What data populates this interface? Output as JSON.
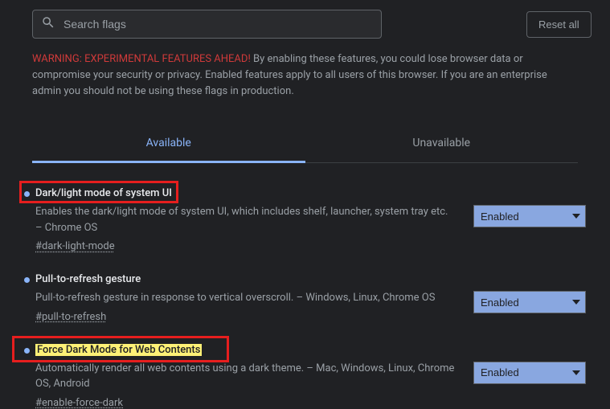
{
  "search": {
    "placeholder": "Search flags"
  },
  "reset_label": "Reset all",
  "warning": {
    "prefix": "WARNING: EXPERIMENTAL FEATURES AHEAD!",
    "body": " By enabling these features, you could lose browser data or compromise your security or privacy. Enabled features apply to all users of this browser. If you are an enterprise admin you should not be using these flags in production."
  },
  "tabs": {
    "available": "Available",
    "unavailable": "Unavailable"
  },
  "flags": [
    {
      "title": "Dark/light mode of system UI",
      "desc": "Enables the dark/light mode of system UI, which includes shelf, launcher, system tray etc. – Chrome OS",
      "hash": "#dark-light-mode",
      "value": "Enabled"
    },
    {
      "title": "Pull-to-refresh gesture",
      "desc": "Pull-to-refresh gesture in response to vertical overscroll. – Windows, Linux, Chrome OS",
      "hash": "#pull-to-refresh",
      "value": "Enabled"
    },
    {
      "title": "Force Dark Mode for Web Contents",
      "desc": "Automatically render all web contents using a dark theme. – Mac, Windows, Linux, Chrome OS, Android",
      "hash": "#enable-force-dark",
      "value": "Enabled"
    }
  ]
}
